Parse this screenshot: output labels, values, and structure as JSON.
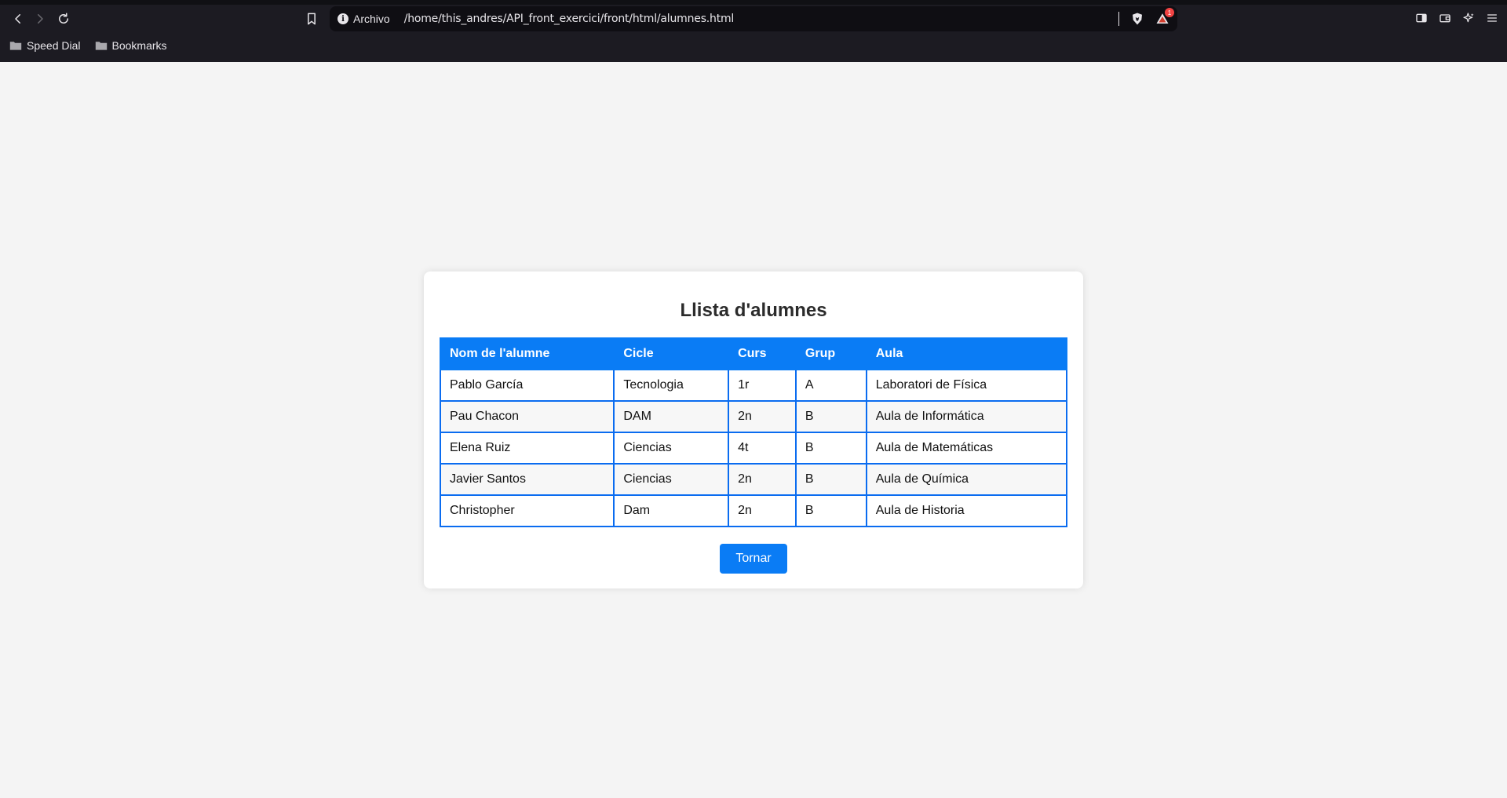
{
  "browser": {
    "url_label": "Archivo",
    "url": "/home/this_andres/API_front_exercici/front/html/alumnes.html",
    "rewards_badge": "1",
    "bookmarks": [
      {
        "label": "Speed Dial"
      },
      {
        "label": "Bookmarks"
      }
    ]
  },
  "page": {
    "title": "Llista d'alumnes",
    "table": {
      "headers": [
        "Nom de l'alumne",
        "Cicle",
        "Curs",
        "Grup",
        "Aula"
      ],
      "rows": [
        [
          "Pablo García",
          "Tecnologia",
          "1r",
          "A",
          "Laboratori de Física"
        ],
        [
          "Pau Chacon",
          "DAM",
          "2n",
          "B",
          "Aula de Informática"
        ],
        [
          "Elena Ruiz",
          "Ciencias",
          "4t",
          "B",
          "Aula de Matemáticas"
        ],
        [
          "Javier Santos",
          "Ciencias",
          "2n",
          "B",
          "Aula de Química"
        ],
        [
          "Christopher",
          "Dam",
          "2n",
          "B",
          "Aula de Historia"
        ]
      ]
    },
    "back_button": "Tornar"
  },
  "colors": {
    "accent": "#0a7cf5",
    "chrome_bg": "#1c1b22",
    "page_bg": "#f4f4f4"
  }
}
